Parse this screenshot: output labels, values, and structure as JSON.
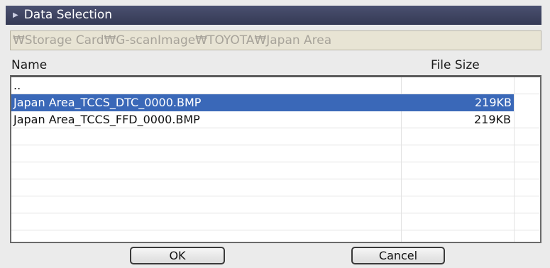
{
  "dialog": {
    "title": "Data Selection",
    "path": "₩Storage Card₩G-scanImage₩TOYOTA₩Japan Area"
  },
  "columns": {
    "name": "Name",
    "size": "File Size"
  },
  "rows": [
    {
      "name": "..",
      "size": ""
    },
    {
      "name": "Japan Area_TCCS_DTC_0000.BMP",
      "size": "219KB",
      "selected": true
    },
    {
      "name": "Japan Area_TCCS_FFD_0000.BMP",
      "size": "219KB"
    }
  ],
  "buttons": {
    "ok": "OK",
    "cancel": "Cancel"
  },
  "colors": {
    "title_bg": "#3f4462",
    "selection": "#3a68b8",
    "path_bg": "#e8e4d4"
  }
}
